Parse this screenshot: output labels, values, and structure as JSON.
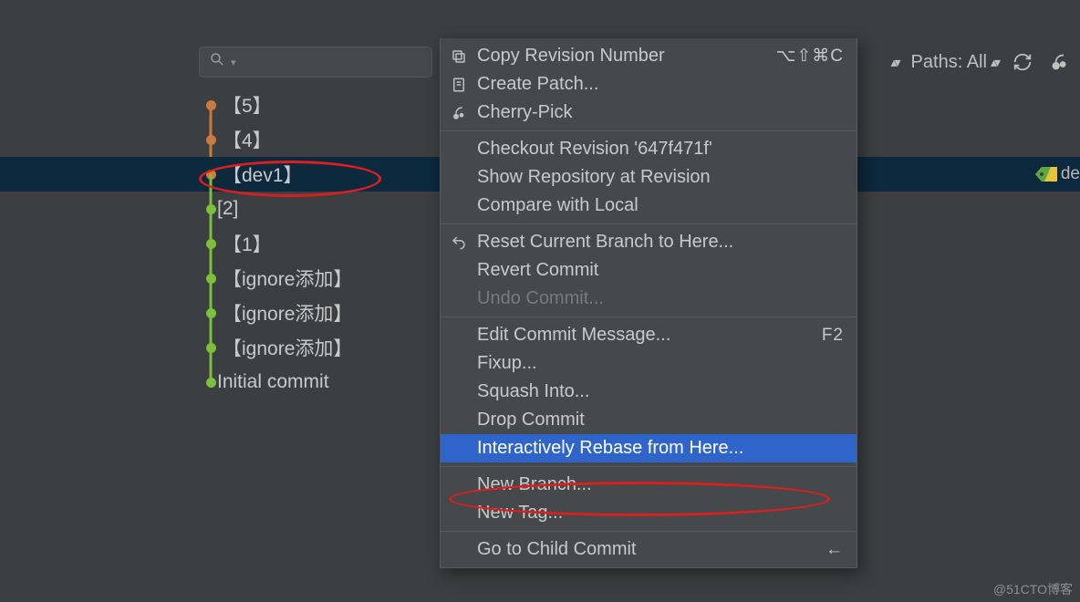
{
  "toolbar": {
    "paths_label": "Paths: All"
  },
  "commits": [
    {
      "label": "【5】",
      "color": "orange",
      "has_selection": false
    },
    {
      "label": "【4】",
      "color": "orange",
      "has_selection": false
    },
    {
      "label": "【dev1】",
      "color": "orange",
      "has_selection": true
    },
    {
      "label": "[2]",
      "color": "green",
      "has_selection": false
    },
    {
      "label": "【1】",
      "color": "green",
      "has_selection": false
    },
    {
      "label": "【ignore添加】",
      "color": "green",
      "has_selection": false
    },
    {
      "label": "【ignore添加】",
      "color": "green",
      "has_selection": false
    },
    {
      "label": "【ignore添加】",
      "color": "green",
      "has_selection": false
    },
    {
      "label": "Initial commit",
      "color": "green",
      "has_selection": false
    }
  ],
  "selected_tag_text": "de",
  "menu": {
    "copy_revision": "Copy Revision Number",
    "copy_shortcut": "⌥⇧⌘C",
    "create_patch": "Create Patch...",
    "cherry_pick": "Cherry-Pick",
    "checkout": "Checkout Revision '647f471f'",
    "show_repo": "Show Repository at Revision",
    "compare_local": "Compare with Local",
    "reset_branch": "Reset Current Branch to Here...",
    "revert_commit": "Revert Commit",
    "undo_commit": "Undo Commit...",
    "edit_msg": "Edit Commit Message...",
    "edit_shortcut": "F2",
    "fixup": "Fixup...",
    "squash": "Squash Into...",
    "drop": "Drop Commit",
    "rebase": "Interactively Rebase from Here...",
    "new_branch": "New Branch...",
    "new_tag": "New Tag...",
    "go_child": "Go to Child Commit"
  },
  "watermark": "@51CTO博客"
}
